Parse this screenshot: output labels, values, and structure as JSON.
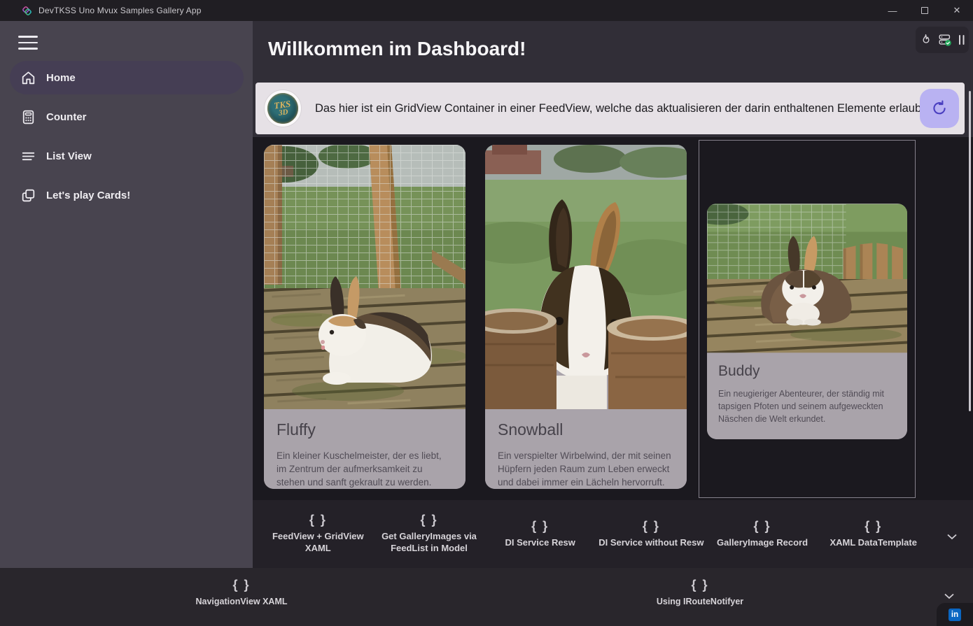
{
  "colors": {
    "accent_lavender": "#b9b2f2",
    "refresh_icon_purple": "#4a3fc0",
    "sidebar_bg": "#48444f",
    "selected_item_bg": "#453e54",
    "banner_bg": "#e6e1e6",
    "card_info_bg": "#a9a3aa",
    "connected_green": "#23a55a",
    "linkedin_blue": "#0a66c2"
  },
  "titlebar": {
    "app_title": "DevTKSS Uno Mvux Samples Gallery App",
    "window_controls": {
      "minimize_glyph": "—",
      "close_glyph": "✕"
    }
  },
  "dev_toolbar": {
    "icons": [
      "hot-reload-flame",
      "server-connected-check",
      "pause-bars"
    ]
  },
  "sidebar": {
    "items": [
      {
        "label": "Home",
        "icon": "home",
        "selected": true
      },
      {
        "label": "Counter",
        "icon": "calculator",
        "selected": false
      },
      {
        "label": "List View",
        "icon": "list",
        "selected": false
      },
      {
        "label": "Let's play Cards!",
        "icon": "cards",
        "selected": false
      }
    ]
  },
  "main": {
    "heading": "Willkommen im Dashboard!",
    "banner": {
      "logo_text_top": "TKS",
      "logo_text_bottom": "3D",
      "text": "Das hier ist ein GridView Container in einer FeedView, welche das aktualisieren der darin enthaltenen Elemente erlaubt!"
    },
    "gallery": [
      {
        "name": "Fluffy",
        "description": "Ein kleiner Kuschelmeister, der es liebt, im Zentrum der aufmerksamkeit zu stehen und sanft gekrault zu werden."
      },
      {
        "name": "Snowball",
        "description": "Ein verspielter Wirbelwind, der mit seinen Hüpfern jeden Raum zum Leben erweckt und dabei immer ein Lächeln hervorruft."
      },
      {
        "name": "Buddy",
        "description": "Ein neugieriger Abenteurer, der ständig mit tapsigen Pfoten und seinem aufgeweckten Näschen die Welt erkundet."
      }
    ],
    "samples": [
      "FeedView + GridView XAML",
      "Get GalleryImages via FeedList in Model",
      "DI Service Resw",
      "DI Service without Resw",
      "GalleryImage Record",
      "XAML DataTemplate"
    ]
  },
  "footer": {
    "items": [
      "NavigationView XAML",
      "Using IRouteNotifyer"
    ]
  },
  "icons": {
    "code_braces": "{ }",
    "linkedin": "in"
  }
}
